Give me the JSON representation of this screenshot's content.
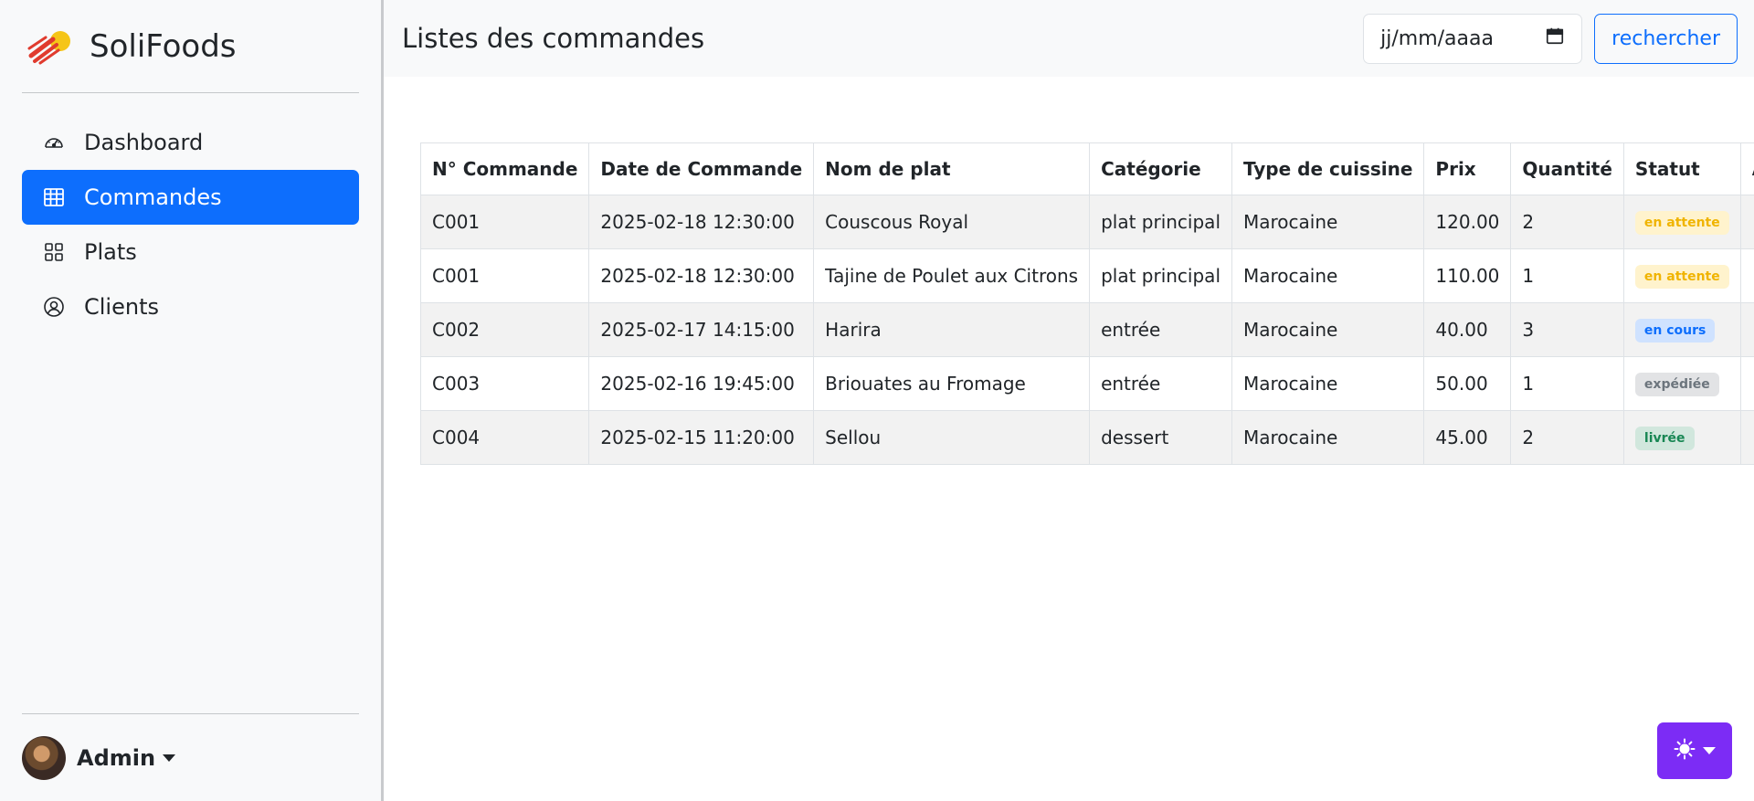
{
  "brand": {
    "name": "SoliFoods"
  },
  "sidebar": {
    "items": [
      {
        "label": "Dashboard",
        "icon": "speedometer-icon",
        "active": false
      },
      {
        "label": "Commandes",
        "icon": "table-icon",
        "active": true
      },
      {
        "label": "Plats",
        "icon": "grid-icon",
        "active": false
      },
      {
        "label": "Clients",
        "icon": "person-circle-icon",
        "active": false
      }
    ],
    "user": {
      "name": "Admin"
    }
  },
  "header": {
    "title": "Listes des commandes",
    "date_placeholder": "jj/mm/aaaa",
    "search_label": "rechercher"
  },
  "table": {
    "columns": [
      "N° Commande",
      "Date de Commande",
      "Nom de plat",
      "Catégorie",
      "Type de cuissine",
      "Prix",
      "Quantité",
      "Statut",
      "Action"
    ],
    "rows": [
      {
        "id": "C001",
        "date": "2025-02-18 12:30:00",
        "plat": "Couscous Royal",
        "categorie": "plat principal",
        "type": "Marocaine",
        "prix": "120.00",
        "quantite": "2",
        "statut": "en attente",
        "statut_class": "attente"
      },
      {
        "id": "C001",
        "date": "2025-02-18 12:30:00",
        "plat": "Tajine de Poulet aux Citrons",
        "categorie": "plat principal",
        "type": "Marocaine",
        "prix": "110.00",
        "quantite": "1",
        "statut": "en attente",
        "statut_class": "attente"
      },
      {
        "id": "C002",
        "date": "2025-02-17 14:15:00",
        "plat": "Harira",
        "categorie": "entrée",
        "type": "Marocaine",
        "prix": "40.00",
        "quantite": "3",
        "statut": "en cours",
        "statut_class": "cours"
      },
      {
        "id": "C003",
        "date": "2025-02-16 19:45:00",
        "plat": "Briouates au Fromage",
        "categorie": "entrée",
        "type": "Marocaine",
        "prix": "50.00",
        "quantite": "1",
        "statut": "expédiée",
        "statut_class": "expediee"
      },
      {
        "id": "C004",
        "date": "2025-02-15 11:20:00",
        "plat": "Sellou",
        "categorie": "dessert",
        "type": "Marocaine",
        "prix": "45.00",
        "quantite": "2",
        "statut": "livrée",
        "statut_class": "livree"
      }
    ]
  },
  "colors": {
    "primary": "#0d6efd",
    "theme_button": "#7c2cf5"
  }
}
